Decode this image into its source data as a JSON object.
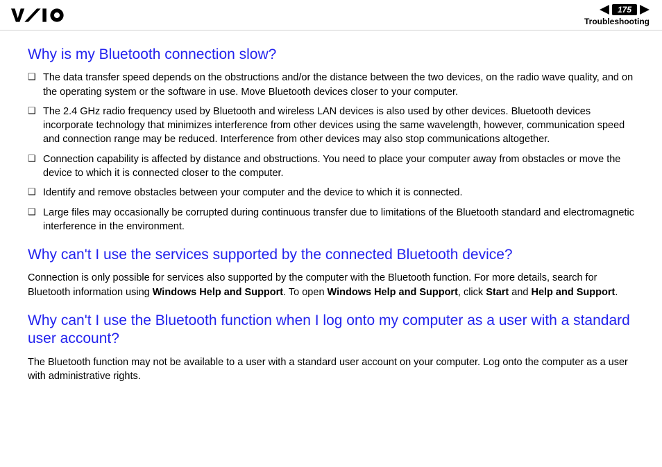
{
  "header": {
    "page_number": "175",
    "section": "Troubleshooting"
  },
  "sections": [
    {
      "heading": "Why is my Bluetooth connection slow?",
      "bullets": [
        "The data transfer speed depends on the obstructions and/or the distance between the two devices, on the radio wave quality, and on the operating system or the software in use. Move Bluetooth devices closer to your computer.",
        "The 2.4 GHz radio frequency used by Bluetooth and wireless LAN devices is also used by other devices. Bluetooth devices incorporate technology that minimizes interference from other devices using the same wavelength, however, communication speed and connection range may be reduced. Interference from other devices may also stop communications altogether.",
        "Connection capability is affected by distance and obstructions. You need to place your computer away from obstacles or move the device to which it is connected closer to the computer.",
        "Identify and remove obstacles between your computer and the device to which it is connected.",
        "Large files may occasionally be corrupted during continuous transfer due to limitations of the Bluetooth standard and electromagnetic interference in the environment."
      ]
    },
    {
      "heading": "Why can't I use the services supported by the connected Bluetooth device?",
      "para_parts": [
        {
          "t": "Connection is only possible for services also supported by the computer with the Bluetooth function. For more details, search for Bluetooth information using ",
          "b": false
        },
        {
          "t": "Windows Help and Support",
          "b": true
        },
        {
          "t": ". To open ",
          "b": false
        },
        {
          "t": "Windows Help and Support",
          "b": true
        },
        {
          "t": ", click ",
          "b": false
        },
        {
          "t": "Start",
          "b": true
        },
        {
          "t": " and ",
          "b": false
        },
        {
          "t": "Help and Support",
          "b": true
        },
        {
          "t": ".",
          "b": false
        }
      ]
    },
    {
      "heading": "Why can't I use the Bluetooth function when I log onto my computer as a user with a standard user account?",
      "para": "The Bluetooth function may not be available to a user with a standard user account on your computer. Log onto the computer as a user with administrative rights."
    }
  ]
}
